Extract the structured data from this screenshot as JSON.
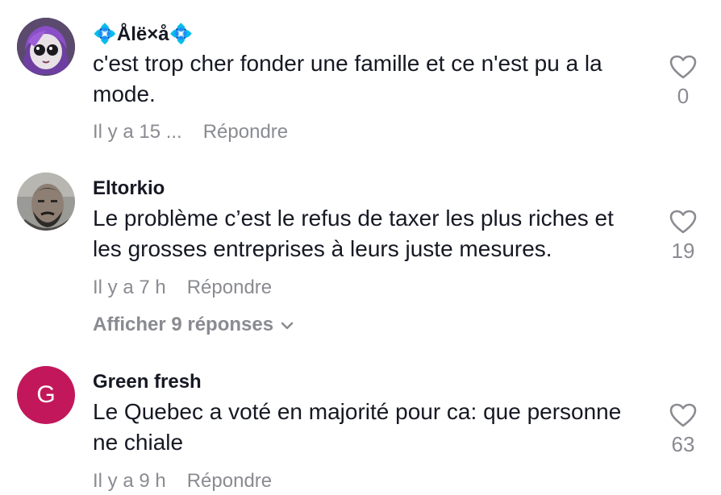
{
  "comments": [
    {
      "username": "💠Ålë×å💠",
      "text": "c'est trop cher fonder une famille et ce n'est pu a la mode.",
      "time": "Il y a 15 ...",
      "reply_label": "Répondre",
      "likes": "0",
      "avatar": "purple-hair-doll-avatar"
    },
    {
      "username": "Eltorkio",
      "text": "Le problème c’est le refus de taxer les plus riches et les grosses entreprises à leurs juste mesures.",
      "time": "Il y a 7 h",
      "reply_label": "Répondre",
      "likes": "19",
      "avatar": "bearded-man-photo-avatar",
      "show_replies": "Afficher 9 réponses"
    },
    {
      "username": "Green fresh",
      "text": "Le Quebec a voté en majorité pour ca: que personne ne chiale",
      "time": "Il y a 9 h",
      "reply_label": "Répondre",
      "likes": "63",
      "avatar_letter": "G",
      "avatar_color": "#c2185b"
    }
  ],
  "colors": {
    "text": "#161823",
    "muted": "#8a8b91",
    "heart_outline": "#8a8b91"
  },
  "icons": [
    "heart-outline-icon",
    "chevron-down-icon"
  ]
}
